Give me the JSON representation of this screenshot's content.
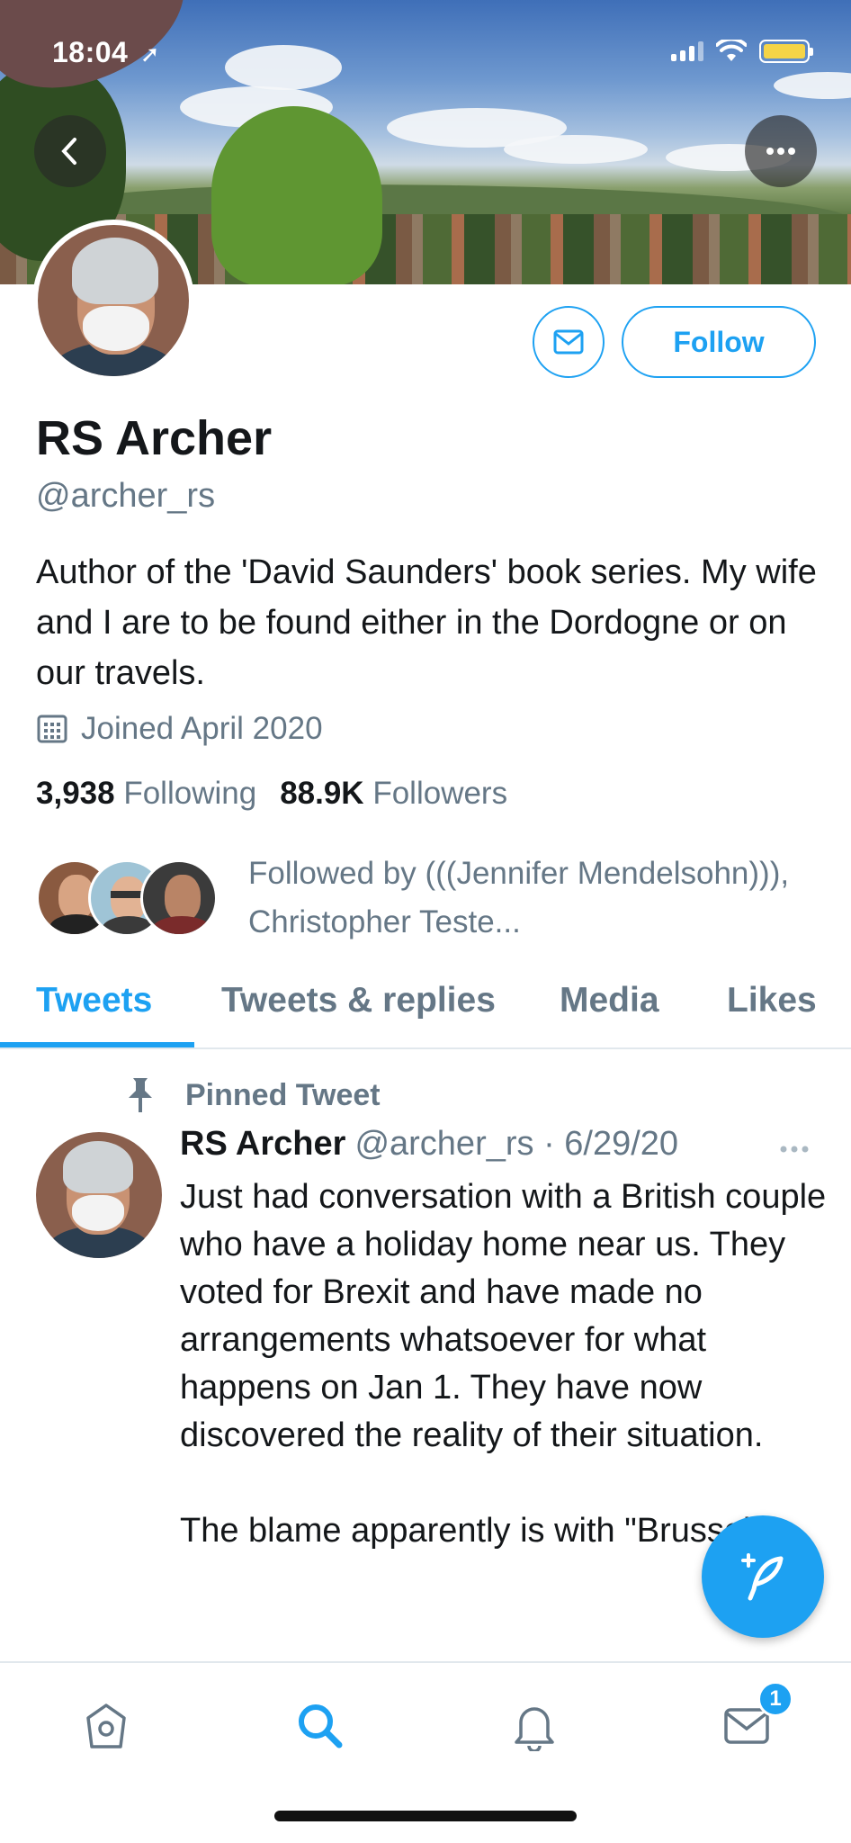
{
  "status_bar": {
    "time": "18:04"
  },
  "banner": {
    "alt_icon": "location-arrow-icon"
  },
  "profile": {
    "name": "RS Archer",
    "handle": "@archer_rs",
    "bio": "Author of the 'David Saunders' book series. My wife and I are to be found either in the Dordogne or on our travels.",
    "joined": "Joined April 2020",
    "following_count": "3,938",
    "following_label": "Following",
    "followers_count": "88.9K",
    "followers_label": "Followers",
    "followed_by": "Followed by (((Jennifer Mendelsohn))), Christopher Teste...",
    "follow_label": "Follow"
  },
  "tabs": [
    {
      "label": "Tweets"
    },
    {
      "label": "Tweets & replies"
    },
    {
      "label": "Media"
    },
    {
      "label": "Likes"
    }
  ],
  "pinned_tweet": {
    "pin_label": "Pinned Tweet",
    "author": "RS Archer",
    "meta": "@archer_rs · 6/29/20",
    "text": "Just had conversation with a British couple who have a holiday home near us.  They voted for Brexit and have made no arrangements whatsoever for what happens on Jan 1.  They have now discovered the reality of their situation.\n\nThe blame apparently is with \"Brussels\"."
  },
  "nav": {
    "messages_badge": "1"
  },
  "colors": {
    "accent": "#1da1f2",
    "secondary_text": "#657786",
    "divider": "#e1e8ed"
  }
}
